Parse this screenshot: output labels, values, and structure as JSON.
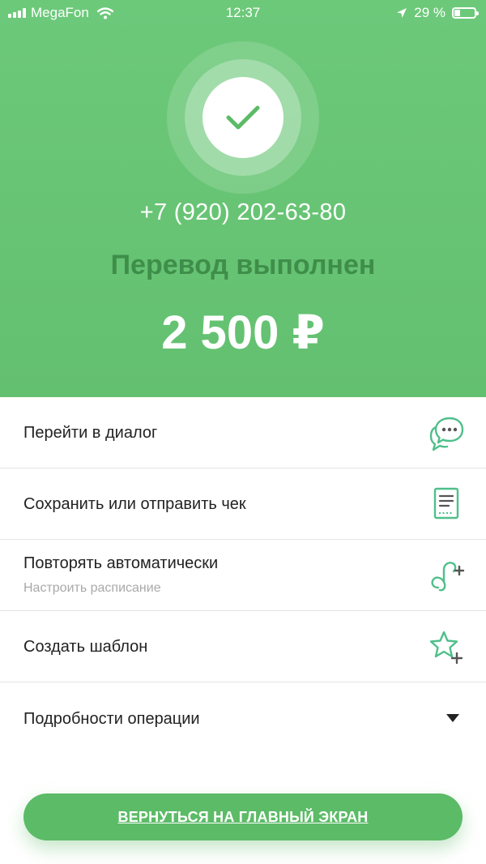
{
  "status_bar": {
    "carrier": "MegaFon",
    "time": "12:37",
    "battery": "29 %",
    "battery_level": 0.29
  },
  "result": {
    "phone": "+7 (920) 202-63-80",
    "title": "Перевод выполнен",
    "amount": "2 500 ₽"
  },
  "actions": [
    {
      "label": "Перейти в диалог",
      "icon": "chat-bubbles-icon"
    },
    {
      "label": "Сохранить или отправить чек",
      "icon": "receipt-icon"
    },
    {
      "label": "Повторять автоматически",
      "sublabel": "Настроить расписание",
      "icon": "repeat-add-icon"
    },
    {
      "label": "Создать шаблон",
      "icon": "star-add-icon"
    },
    {
      "label": "Подробности операции",
      "icon": "triangle-down-icon"
    }
  ],
  "footer": {
    "home_button": "ВЕРНУТЬСЯ НА ГЛАВНЫЙ ЭКРАН"
  },
  "colors": {
    "hero_green": "#66c473",
    "title_dark_green": "#3e8e4a",
    "accent_green": "#5cbb67",
    "icon_teal": "#4fbf8a"
  }
}
